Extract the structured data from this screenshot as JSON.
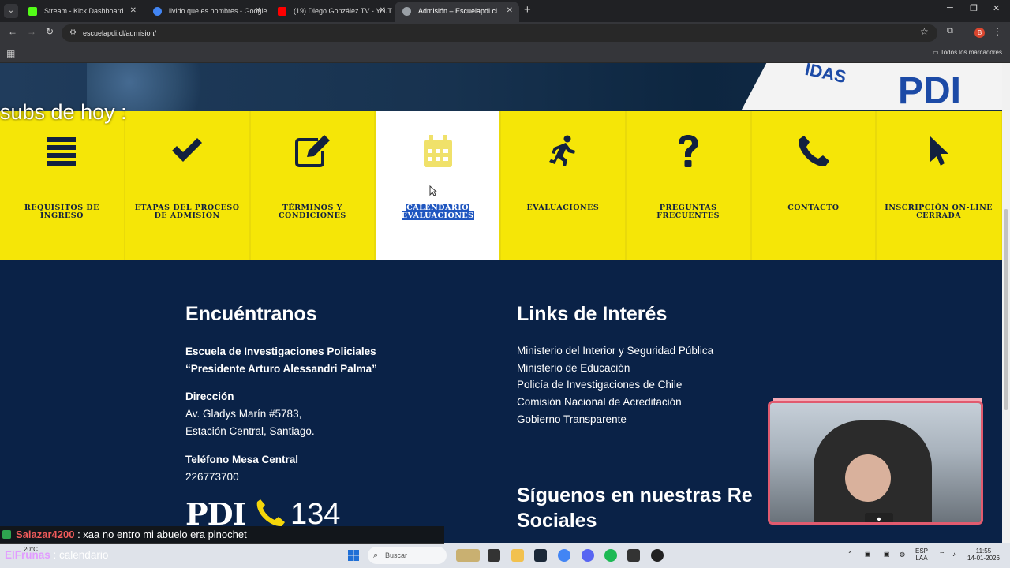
{
  "browser": {
    "tabs": [
      {
        "title": "Stream - Kick Dashboard",
        "favicon_color": "#53fc18",
        "active": false
      },
      {
        "title": "livido que es hombres - Google",
        "favicon_color": "#4285f4",
        "active": false
      },
      {
        "title": "(19) Diego González TV - YouTu",
        "favicon_color": "#ff0000",
        "active": false
      },
      {
        "title": "Admisión – Escuelapdi.cl",
        "favicon_color": "#9aa0a6",
        "active": true
      }
    ],
    "url": "escuelapdi.cl/admision/",
    "profile_initial": "B",
    "bookmarks_folder": "Todos los marcadores"
  },
  "overlay": {
    "subs_text": "subs de hoy :"
  },
  "hero": {
    "banner_text": "IDAS",
    "banner_big": "PDI"
  },
  "tiles": [
    {
      "label": "REQUISITOS DE INGRESO",
      "icon": "list-icon",
      "active": false
    },
    {
      "label": "ETAPAS DEL PROCESO DE ADMISIÓN",
      "icon": "checkmark-icon",
      "active": false
    },
    {
      "label": "TÉRMINOS Y CONDICIONES",
      "icon": "edit-icon",
      "active": false
    },
    {
      "label": "CALENDARIO EVALUACIONES",
      "icon": "calendar-icon",
      "active": true
    },
    {
      "label": "EVALUACIONES",
      "icon": "running-icon",
      "active": false
    },
    {
      "label": "PREGUNTAS FRECUENTES",
      "icon": "question-icon",
      "active": false
    },
    {
      "label": "CONTACTO",
      "icon": "phone-icon",
      "active": false
    },
    {
      "label": "INSCRIPCIÓN ON-LINE CERRADA",
      "icon": "pointer-icon",
      "active": false
    }
  ],
  "footer": {
    "find_us": {
      "heading": "Encuéntranos",
      "school_line1": "Escuela de Investigaciones Policiales",
      "school_line2": "“Presidente Arturo Alessandri Palma”",
      "address_label": "Dirección",
      "address_line1": "Av. Gladys Marín #5783,",
      "address_line2": "Estación Central, Santiago.",
      "phone_label": "Teléfono Mesa Central",
      "phone_value": "226773700",
      "logo_text": "PDI",
      "hotline": "134"
    },
    "links": {
      "heading": "Links de Interés",
      "items": [
        "Ministerio del Interior y Seguridad Pública",
        "Ministerio de Educación",
        "Policía de Investigaciones de Chile",
        "Comisión Nacional de Acreditación",
        "Gobierno Transparente"
      ]
    },
    "social": {
      "heading_line1": "Síguenos en nuestras Re",
      "heading_line2": "Sociales"
    }
  },
  "chat": {
    "message1_user": "Salazar4200",
    "message1_text": ": xaa no entro mi abuelo era pinochet",
    "message2_user": "ElFrunas",
    "message2_text": ": calendario"
  },
  "taskbar": {
    "search_placeholder": "Buscar",
    "weather": "20°C",
    "lang_line1": "ESP",
    "lang_line2": "LAA",
    "time": "11:55",
    "date": "14-01-2026"
  }
}
